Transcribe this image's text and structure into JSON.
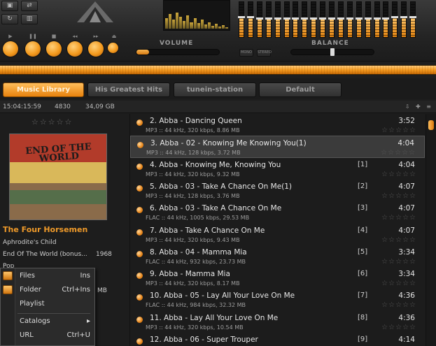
{
  "player": {
    "volume_label": "VOLUME",
    "balance_label": "BALANCE",
    "toggle_left": "MONO",
    "toggle_right": "STEREO",
    "volume_level": 0.15,
    "balance_level": 0.5,
    "eq_levels": [
      0.55,
      0.55,
      0.5,
      0.5,
      0.5,
      0.5,
      0.5,
      0.5,
      0.5,
      0.5,
      0.5,
      0.5,
      0.5,
      0.5,
      0.5,
      0.5,
      0.5,
      0.55,
      0.55,
      0.55
    ],
    "accent_color": "#f39a1e"
  },
  "tabs": [
    {
      "label": "Music Library",
      "active": true
    },
    {
      "label": "His Greatest Hits",
      "active": false
    },
    {
      "label": "tunein-station",
      "active": false
    },
    {
      "label": "Default",
      "active": false
    }
  ],
  "status": {
    "time": "15:04:15:59",
    "count": "4830",
    "size": "34,09 GB"
  },
  "sidebar": {
    "cover_text": "END OF THE WORLD",
    "artist": "The Four Horsemen",
    "album": "Aphrodite's Child",
    "track": "End Of The World (bonus...",
    "year": "1968",
    "genre": "Pop",
    "size_partial": "MB"
  },
  "menu": {
    "items": [
      {
        "label": "Files",
        "shortcut": "Ins",
        "icon": "add-files-icon"
      },
      {
        "label": "Folder",
        "shortcut": "Ctrl+Ins",
        "icon": "add-folder-icon"
      },
      {
        "label": "Playlist",
        "shortcut": ""
      },
      {
        "label": "Catalogs",
        "shortcut": "▸"
      },
      {
        "label": "URL",
        "shortcut": "Ctrl+U"
      }
    ]
  },
  "playlist": {
    "rows": [
      {
        "title": "2. Abba - Dancing Queen",
        "meta": "MP3 :: 44 kHz, 320 kbps, 8.86 MB",
        "idx": "",
        "dur": "3:52",
        "selected": false
      },
      {
        "title": "3. Abba - 02 - Knowing Me Knowing You(1)",
        "meta": "MP3 :: 44 kHz, 128 kbps, 3.72 MB",
        "idx": "",
        "dur": "4:04",
        "selected": true
      },
      {
        "title": "4. Abba - Knowing Me, Knowing You",
        "meta": "MP3 :: 44 kHz, 320 kbps, 9.32 MB",
        "idx": "[1]",
        "dur": "4:04",
        "selected": false
      },
      {
        "title": "5. Abba - 03 - Take A Chance On Me(1)",
        "meta": "MP3 :: 44 kHz, 128 kbps, 3.76 MB",
        "idx": "[2]",
        "dur": "4:07",
        "selected": false
      },
      {
        "title": "6. Abba - 03 - Take A Chance On Me",
        "meta": "FLAC :: 44 kHz, 1005 kbps, 29.53 MB",
        "idx": "[3]",
        "dur": "4:07",
        "selected": false
      },
      {
        "title": "7. Abba - Take A Chance On Me",
        "meta": "MP3 :: 44 kHz, 320 kbps, 9.43 MB",
        "idx": "[4]",
        "dur": "4:07",
        "selected": false
      },
      {
        "title": "8. Abba - 04 - Mamma Mia",
        "meta": "FLAC :: 44 kHz, 932 kbps, 23.73 MB",
        "idx": "[5]",
        "dur": "3:34",
        "selected": false
      },
      {
        "title": "9. Abba - Mamma Mia",
        "meta": "MP3 :: 44 kHz, 320 kbps, 8.17 MB",
        "idx": "[6]",
        "dur": "3:34",
        "selected": false
      },
      {
        "title": "10. Abba - 05 - Lay All Your Love On Me",
        "meta": "FLAC :: 44 kHz, 984 kbps, 32.32 MB",
        "idx": "[7]",
        "dur": "4:36",
        "selected": false
      },
      {
        "title": "11. Abba - Lay All Your Love On Me",
        "meta": "MP3 :: 44 kHz, 320 kbps, 10.54 MB",
        "idx": "[8]",
        "dur": "4:36",
        "selected": false
      },
      {
        "title": "12. Abba - 06 - Super Trouper",
        "meta": "",
        "idx": "[9]",
        "dur": "4:14",
        "selected": false
      }
    ],
    "star_glyphs": "☆☆☆☆☆"
  }
}
